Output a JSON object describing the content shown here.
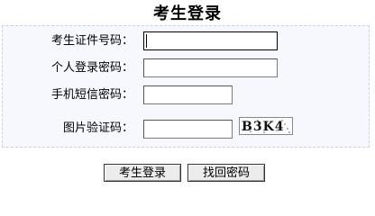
{
  "title": "考生登录",
  "form": {
    "id_label": "考生证件号码：",
    "id_value": "",
    "password_label": "个人登录密码：",
    "password_value": "",
    "sms_label": "手机短信密码：",
    "sms_value": "",
    "captcha_label": "图片验证码：",
    "captcha_value": "",
    "captcha_image_text": "B3K4"
  },
  "buttons": {
    "login": "考生登录",
    "recover": "找回密码"
  },
  "colors": {
    "panel_background": "#f6f8fd",
    "panel_border": "#c8d2e6",
    "button_face": "#ececec"
  }
}
